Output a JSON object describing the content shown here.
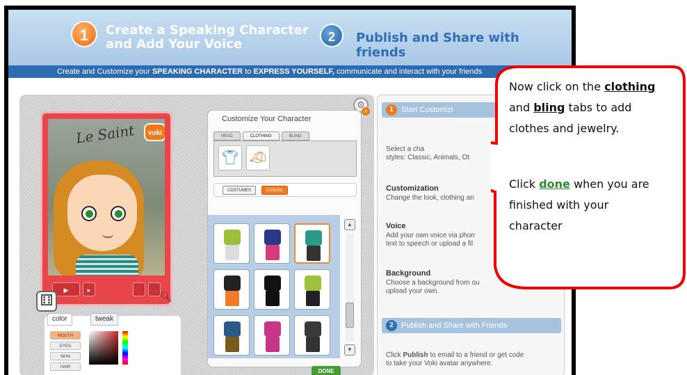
{
  "header": {
    "step1_number": "1",
    "step1_title": "Create a Speaking Character\nand Add Your Voice",
    "step2_number": "2",
    "step2_title": "Publish and Share with friends",
    "subtitle_pre": "Create and Customize your ",
    "subtitle_b1": "SPEAKING CHARACTER",
    "subtitle_mid": " to ",
    "subtitle_b2": "EXPRESS YOURSELF,",
    "subtitle_post": " communicate and interact with your friends"
  },
  "character": {
    "graffiti": "Le Saint",
    "badge": "voki"
  },
  "color_panel": {
    "color_tab": "color",
    "tweak_tab": "tweak",
    "buttons": [
      "MOUTH",
      "EYES",
      "SKIN",
      "HAIR"
    ]
  },
  "customize": {
    "title": "Customize Your Character",
    "tabs": [
      "HEAD",
      "CLOTHING",
      "BLING"
    ],
    "filters": [
      "COSTUMES",
      "CASUAL"
    ],
    "done_label": "DONE"
  },
  "outfits": [
    {
      "top": "#9bbf3a",
      "bottom": "#ddd"
    },
    {
      "top": "#2a3a8a",
      "bottom": "#d63c7a"
    },
    {
      "top": "#2a9a8a",
      "bottom": "#333"
    },
    {
      "top": "#222",
      "bottom": "#f07a28"
    },
    {
      "top": "#111",
      "bottom": "#111"
    },
    {
      "top": "#a0c23a",
      "bottom": "#222"
    },
    {
      "top": "#2a5a8a",
      "bottom": "#7a5a1a"
    },
    {
      "top": "#c7358a",
      "bottom": "#c7358a"
    },
    {
      "top": "#3a3a3a",
      "bottom": "#333"
    }
  ],
  "sidebar": {
    "step1_number": "1",
    "step1_header": "Start Customizi",
    "intro_lines": [
      "Select a cha",
      "styles: Classic, Animals, Ot"
    ],
    "sections": [
      {
        "heading": "Customization",
        "text": "Change the look, clothing an"
      },
      {
        "heading": "Voice",
        "lines": [
          "Add your own voice via phon",
          "text to speech or upload a fil"
        ]
      },
      {
        "heading": "Background",
        "lines": [
          "Choose a background from ou",
          "upload your own."
        ]
      }
    ],
    "step2_number": "2",
    "step2_header": "Publish and Share with Friends",
    "publish_pre": "Click ",
    "publish_bold": "Publish",
    "publish_post": " to email to a friend or get code",
    "publish_line2": "to take your Voki avatar anywhere."
  },
  "callout": {
    "line1_pre": "Now click on the ",
    "line1_u": "clothing",
    "line2_pre": "and ",
    "line2_u": "bling",
    "line2_post": " tabs to add",
    "line3": "clothes and jewelry.",
    "line4_pre": "Click ",
    "line4_u": "done",
    "line4_post": " when you are",
    "line5": "finished with your",
    "line6": "character"
  }
}
